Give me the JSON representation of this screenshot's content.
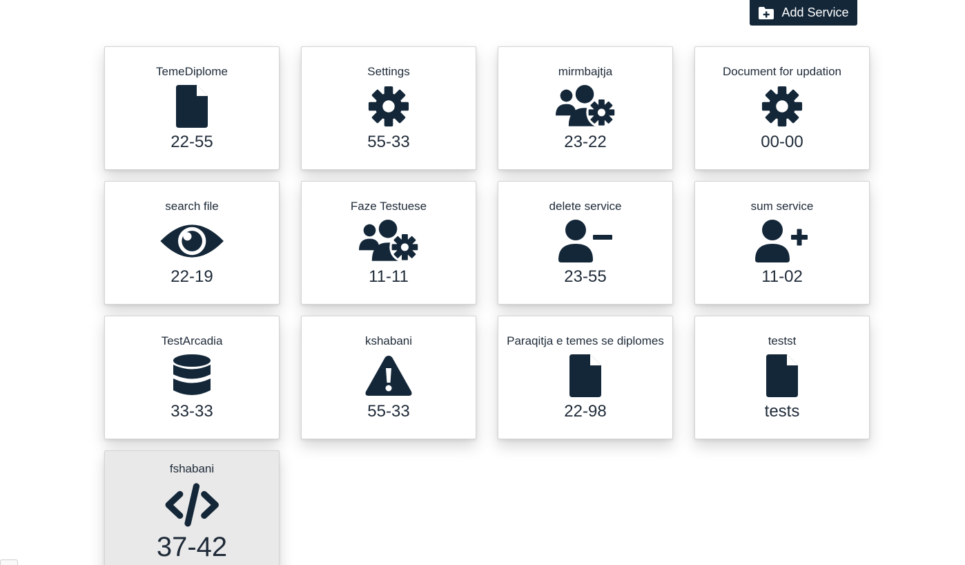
{
  "toolbar": {
    "add_label": "Add Service",
    "add_icon": "folder-plus-icon",
    "button_color": "#142739"
  },
  "theme": {
    "icon_color": "#142739",
    "card_background": "#ffffff",
    "active_card_background": "#e9e9e9"
  },
  "services": [
    {
      "title": "TemeDiplome",
      "code": "22-55",
      "icon": "file-icon"
    },
    {
      "title": "Settings",
      "code": "55-33",
      "icon": "gear-icon"
    },
    {
      "title": "mirmbajtja",
      "code": "23-22",
      "icon": "users-gear-icon"
    },
    {
      "title": "Document for updation",
      "code": "00-00",
      "icon": "gear-icon"
    },
    {
      "title": "search file",
      "code": "22-19",
      "icon": "eye-icon"
    },
    {
      "title": "Faze Testuese",
      "code": "11-11",
      "icon": "users-gear-icon"
    },
    {
      "title": "delete service",
      "code": "23-55",
      "icon": "user-minus-icon"
    },
    {
      "title": "sum service",
      "code": "11-02",
      "icon": "user-plus-icon"
    },
    {
      "title": "TestArcadia",
      "code": "33-33",
      "icon": "database-icon"
    },
    {
      "title": "kshabani",
      "code": "55-33",
      "icon": "warning-icon"
    },
    {
      "title": "Paraqitja e temes se diplomes",
      "code": "22-98",
      "icon": "file-icon"
    },
    {
      "title": "testst",
      "code": "tests",
      "icon": "file-icon"
    },
    {
      "title": "fshabani",
      "code": "37-42",
      "icon": "code-icon",
      "active": true
    }
  ]
}
